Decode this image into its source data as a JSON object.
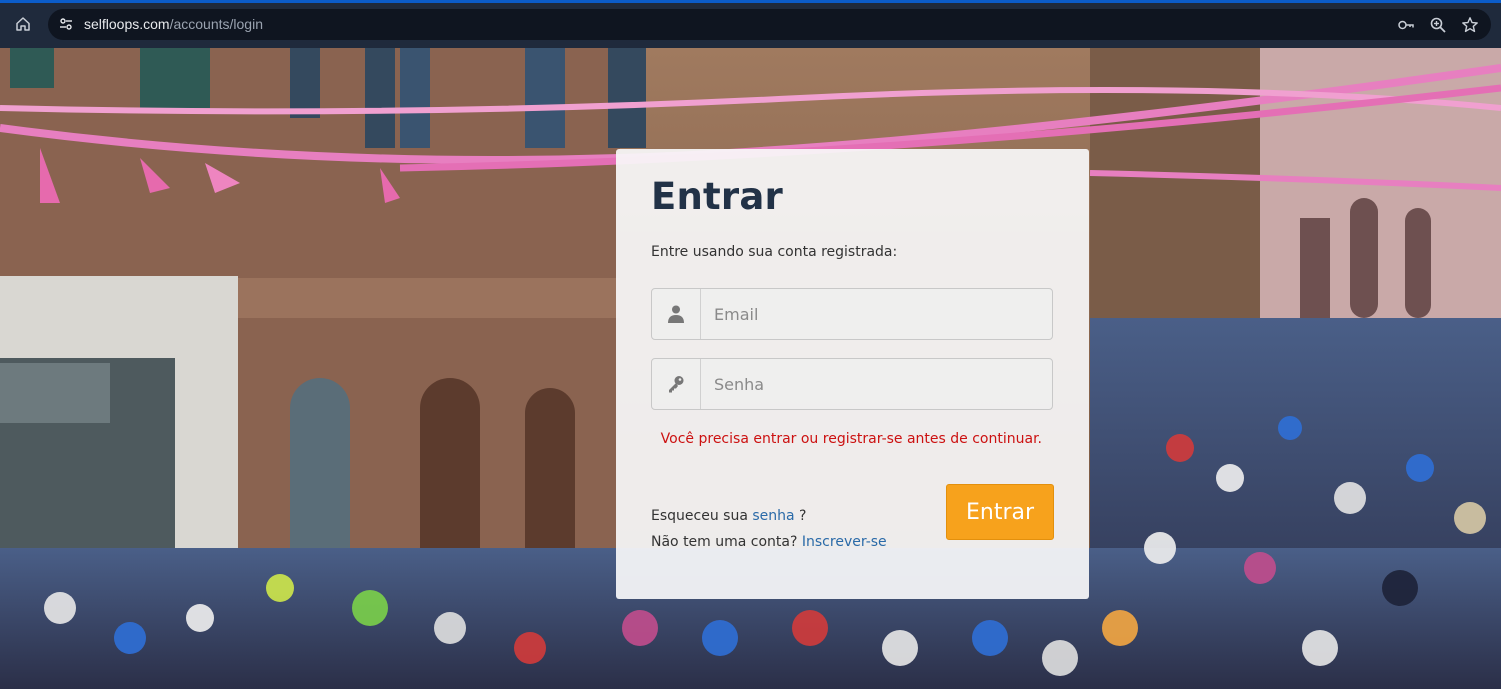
{
  "browser": {
    "url_host": "selfloops.com",
    "url_path": "/accounts/login",
    "icons": [
      "home-icon",
      "site-settings-icon",
      "key-icon",
      "zoom-icon",
      "star-icon"
    ]
  },
  "login": {
    "title": "Entrar",
    "subtitle": "Entre usando sua conta registrada:",
    "email_placeholder": "Email",
    "password_placeholder": "Senha",
    "alert": "Você precisa entrar ou registrar-se antes de continuar.",
    "forgot_prefix": "Esqueceu sua",
    "forgot_link": "senha",
    "forgot_suffix": " ?",
    "signup_prefix": "Não tem uma conta?",
    "signup_link": "Inscrever-se",
    "submit_label": "Entrar"
  },
  "colors": {
    "accent_button": "#f7a21c",
    "alert": "#cc1111",
    "link": "#2a6aa8",
    "title": "#223247"
  }
}
